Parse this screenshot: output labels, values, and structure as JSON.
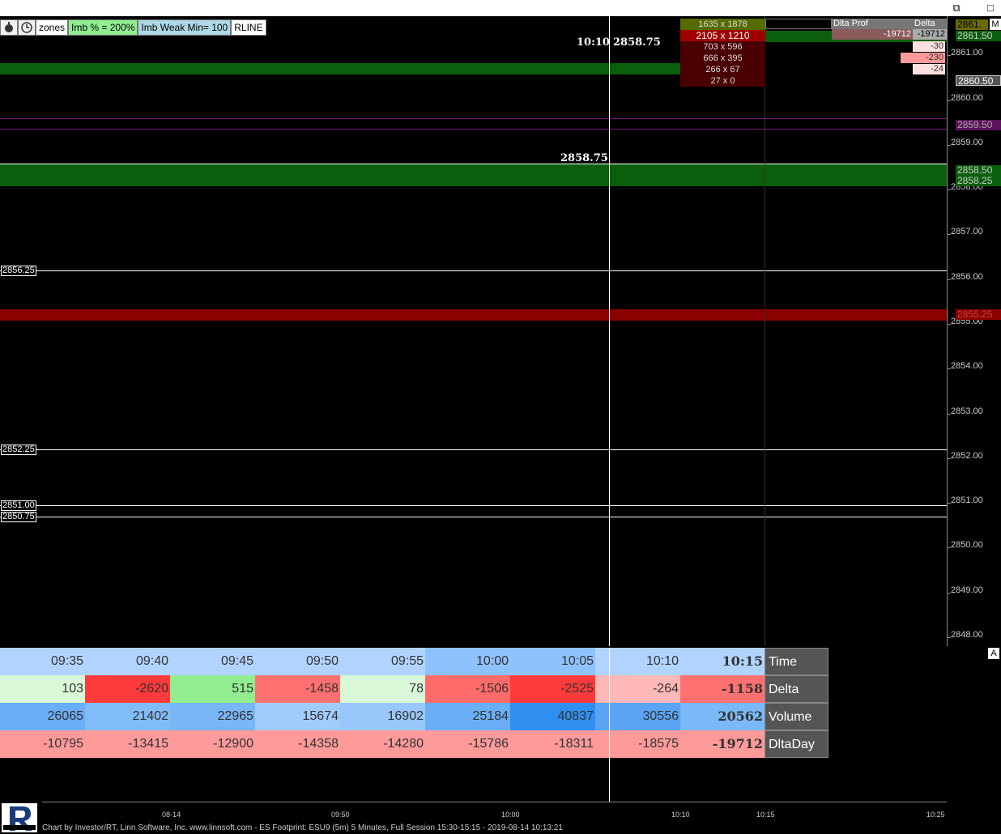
{
  "toolbar": {
    "zones": "zones",
    "imb_pct": "Imb % = 200%",
    "imb_weak": "Imb Weak Min= 100",
    "rline": "RLINE"
  },
  "crosshair": {
    "label": "10:10",
    "price": "2858.75",
    "price_left": "2858.75"
  },
  "price_labels": [
    "2856.25",
    "2852.25",
    "2851.00",
    "2850.75"
  ],
  "yaxis": {
    "ticks": [
      "2861.00",
      "2860.00",
      "2859.00",
      "2858.00",
      "2857.00",
      "2856.00",
      "2855.00",
      "2854.00",
      "2853.00",
      "2852.00",
      "2851.00",
      "2850.00",
      "2849.00",
      "2848.00"
    ],
    "marks": {
      "top": "2861.",
      "top2": "2861.50",
      "last": "2860.50",
      "purple": "2859.50",
      "green1": "2858.50",
      "green2": "2858.25",
      "red": "2855.25"
    },
    "m_button": "M",
    "a_button": "A"
  },
  "footprint": [
    "1635 x 1878",
    "2105 x 1210",
    "703 x 596",
    "666 x 395",
    "266 x 67",
    "27 x 0"
  ],
  "delta_profile": {
    "header_left": "Dlta Prof",
    "header_right": "Delta",
    "val_left": "-19712",
    "val_right": "-19712",
    "rows": [
      "-30",
      "-230",
      "-24"
    ]
  },
  "table": {
    "labels": [
      "Time",
      "Delta",
      "Volume",
      "DltaDay"
    ],
    "time": [
      "09:35",
      "09:40",
      "09:45",
      "09:50",
      "09:55",
      "10:00",
      "10:05",
      "10:10",
      "10:15"
    ],
    "delta": [
      "103",
      "-2620",
      "515",
      "-1458",
      "78",
      "-1506",
      "-2525",
      "-264",
      "-1158"
    ],
    "volume": [
      "26065",
      "21402",
      "22965",
      "15674",
      "16902",
      "25184",
      "40837",
      "30556",
      "20562"
    ],
    "dltaday": [
      "-10795",
      "-13415",
      "-12900",
      "-14358",
      "-14280",
      "-15786",
      "-18311",
      "-18575",
      "-19712"
    ]
  },
  "xaxis": {
    "ticks": [
      "08-14",
      "09:50",
      "10:00",
      "10:10",
      "10:15",
      "10:25"
    ]
  },
  "footer": "Chart by Investor/RT, Linn Software, Inc. www.linnsoft.com - ES Footprint: ESU9 (5m) 5 Minutes, Full Session 15:30-15:15 - 2019-08-14 10:13:21",
  "colors": {
    "green_zone": "#0b5e0b",
    "red_zone": "#8b0000",
    "purple_line": "#7a1a7a"
  }
}
